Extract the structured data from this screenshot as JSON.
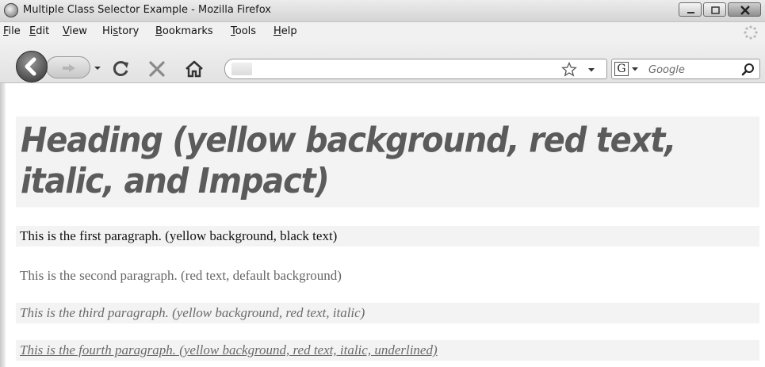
{
  "window": {
    "title": "Multiple Class Selector Example - Mozilla Firefox"
  },
  "menu": {
    "items": [
      {
        "accel": "F",
        "rest": "ile"
      },
      {
        "accel": "E",
        "rest": "dit"
      },
      {
        "accel": "V",
        "rest": "iew"
      },
      {
        "pre": "Hi",
        "accel": "s",
        "rest": "tory"
      },
      {
        "accel": "B",
        "rest": "ookmarks"
      },
      {
        "accel": "T",
        "rest": "ools"
      },
      {
        "accel": "H",
        "rest": "elp"
      }
    ]
  },
  "toolbar": {
    "url_value": "",
    "search_engine_letter": "G",
    "search_placeholder": "Google"
  },
  "page": {
    "heading": "Heading (yellow background, red text, italic, and Impact)",
    "paragraphs": [
      "This is the first paragraph. (yellow background, black text)",
      "This is the second paragraph. (red text, default background)",
      "This is the third paragraph. (yellow background, red text, italic)",
      "This is the fourth paragraph. (yellow background, red text, italic, underlined)"
    ]
  },
  "colors": {
    "highlight_background": "#f3f3f3",
    "heading_text": "#5b5b5b",
    "muted_text": "#6a6a6a"
  }
}
